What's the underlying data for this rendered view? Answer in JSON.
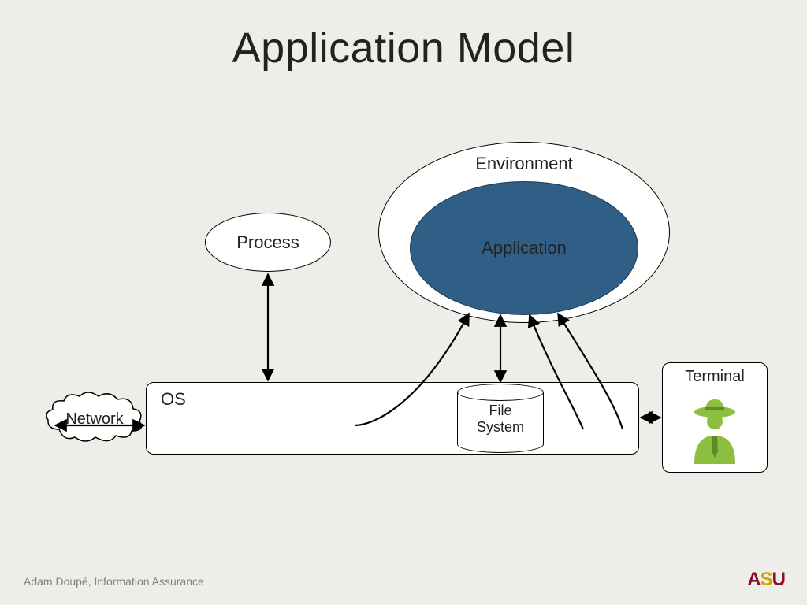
{
  "title": "Application Model",
  "footer": "Adam Doupé, Information Assurance",
  "logo": {
    "a": "A",
    "s": "S",
    "u": "U"
  },
  "nodes": {
    "environment": "Environment",
    "application": "Application",
    "process": "Process",
    "os": "OS",
    "network": "Network",
    "terminal": "Terminal",
    "filesystem_l1": "File",
    "filesystem_l2": "System"
  },
  "colors": {
    "application_fill": "#2f5e87",
    "agent_green": "#8cbf3f"
  },
  "edges": [
    {
      "from": "OS",
      "to": "Process",
      "bidirectional": true
    },
    {
      "from": "OS",
      "to": "Network",
      "bidirectional": true
    },
    {
      "from": "OS",
      "to": "Terminal",
      "bidirectional": true
    },
    {
      "from": "OS",
      "to": "Application",
      "via": "curve-left",
      "bidirectional": false,
      "direction": "to-application"
    },
    {
      "from": "FileSystem",
      "to": "Application",
      "bidirectional": true
    },
    {
      "from": "Terminal-path",
      "to": "Application",
      "via": "curve-right",
      "bidirectional": false,
      "direction": "to-application"
    },
    {
      "from": "Network-path",
      "to": "Application",
      "via": "curve-far-right",
      "bidirectional": false,
      "direction": "to-application"
    }
  ]
}
